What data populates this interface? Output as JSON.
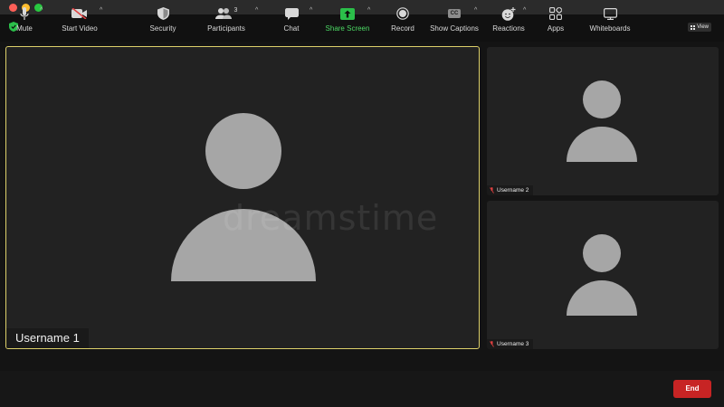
{
  "window": {
    "controls": [
      "close",
      "minimize",
      "maximize"
    ]
  },
  "topbar": {
    "view_label": "View",
    "security_icon": "shield-check-icon"
  },
  "tiles": [
    {
      "name": "Username 1",
      "active_speaker": true
    },
    {
      "name": "Username 2",
      "muted": true
    },
    {
      "name": "Username 3",
      "muted": true
    }
  ],
  "watermark": "dreamstime",
  "toolbar": {
    "mute": "Mute",
    "start_video": "Start Video",
    "security": "Security",
    "participants": "Participants",
    "participants_count": "3",
    "chat": "Chat",
    "share_screen": "Share Screen",
    "record": "Record",
    "show_captions": "Show Captions",
    "captions_badge": "CC",
    "reactions": "Reactions",
    "apps": "Apps",
    "whiteboards": "Whiteboards",
    "end": "End"
  },
  "colors": {
    "active_border": "#ddd06a",
    "end_button": "#c72424",
    "share_screen": "#4cd964",
    "avatar": "#a6a6a6"
  }
}
